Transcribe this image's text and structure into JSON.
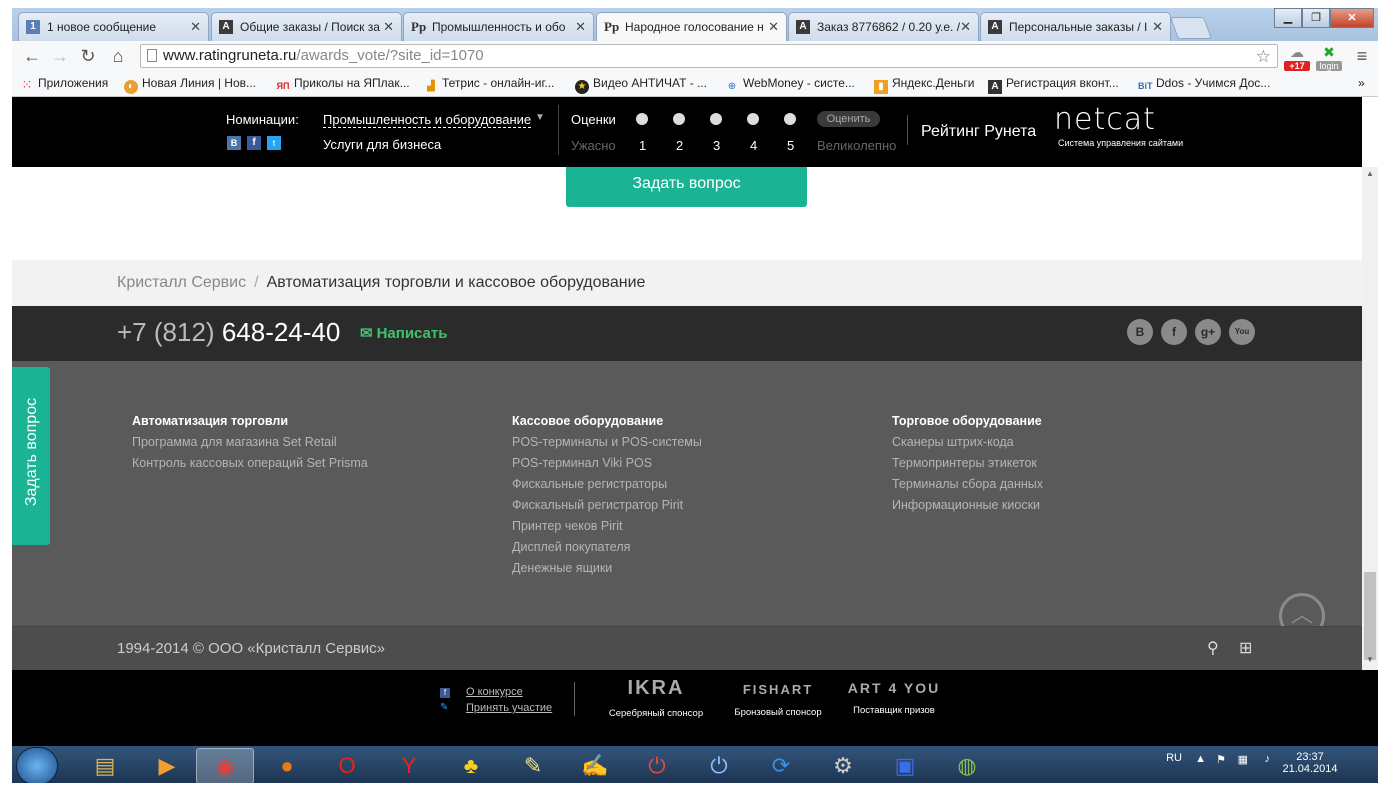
{
  "browser": {
    "tabs": [
      {
        "label": "1 новое сообщение",
        "icon": "1",
        "active": false
      },
      {
        "label": "Общие заказы / Поиск за",
        "icon": "A",
        "active": false
      },
      {
        "label": "Промышленность и обо",
        "icon": "Pp",
        "active": false
      },
      {
        "label": "Народное голосование н",
        "icon": "Pp",
        "active": true
      },
      {
        "label": "Заказ 8776862 / 0.20 у.е. /",
        "icon": "A",
        "active": false
      },
      {
        "label": "Персональные заказы / I",
        "icon": "A",
        "active": false
      }
    ],
    "url_host": "www.ratingruneta.ru",
    "url_path": "/awards_vote/?site_id=1070",
    "ext_badge": "+17",
    "ext_login": "login",
    "bookmarks": [
      "Приложения",
      "Новая Линия | Нов...",
      "Приколы на ЯПлак...",
      "Тетрис - онлайн-иг...",
      "Видео АНТИЧАТ - ...",
      "WebMoney - систе...",
      "Яндекс.Деньги",
      "Регистрация вконт...",
      "Ddos - Учимся Дос..."
    ],
    "bookmarks_more": "»"
  },
  "rating_bar": {
    "nominations_label": "Номинации:",
    "nomination_primary": "Промышленность и оборудование",
    "nomination_secondary": "Услуги для бизнеса",
    "scores_label": "Оценки",
    "score_min": "Ужасно",
    "score_max": "Великолепно",
    "scores": [
      "1",
      "2",
      "3",
      "4",
      "5"
    ],
    "rate_button": "Оценить",
    "brand": "Рейтинг Рунета",
    "netcat_logo": "netcat",
    "netcat_sub": "Система управления сайтами"
  },
  "page": {
    "ask_button": "Задать вопрос",
    "breadcrumb_company": "Кристалл Сервис",
    "breadcrumb_sep": "/",
    "breadcrumb_current": "Автоматизация торговли и кассовое оборудование",
    "phone_code": "+7 (812)",
    "phone_number": "648-24-40",
    "write_label": "Написать",
    "columns": [
      {
        "title": "Автоматизация торговли",
        "links": [
          "Программа для магазина Set Retail",
          "Контроль кассовых операций Set Prisma"
        ]
      },
      {
        "title": "Кассовое оборудование",
        "links": [
          "POS-терминалы и POS-системы",
          "POS-терминал Viki POS",
          "Фискальные регистраторы",
          "Фискальный регистратор Pirit",
          "Принтер чеков Pirit",
          "Дисплей покупателя",
          "Денежные ящики"
        ]
      },
      {
        "title": "Торговое оборудование",
        "links": [
          "Сканеры штрих-кода",
          "Термопринтеры этикеток",
          "Терминалы сбора данных",
          "Информационные киоски"
        ]
      }
    ],
    "copyright": "1994-2014 © ООО «Кристалл Сервис»",
    "side_tab": "Задать вопрос"
  },
  "sponsors": {
    "about": "О конкурсе",
    "join": "Принять участие",
    "items": [
      {
        "logo": "IKRA",
        "caption": "Серебряный спонсор"
      },
      {
        "logo": "FISHART",
        "caption": "Бронзовый спонсор"
      },
      {
        "logo": "ART 4 YOU",
        "caption": "Поставщик призов"
      }
    ]
  },
  "taskbar": {
    "lang": "RU",
    "time": "23:37",
    "date": "21.04.2014"
  }
}
